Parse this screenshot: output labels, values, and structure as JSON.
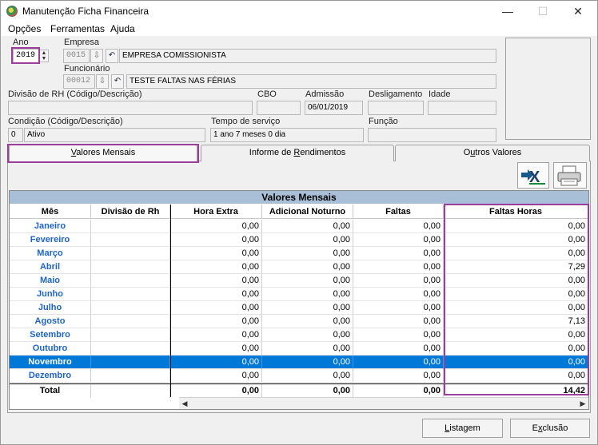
{
  "window": {
    "title": "Manutenção Ficha Financeira",
    "minimize": "—",
    "maximize": "☐",
    "close": "✕"
  },
  "menu": {
    "items": [
      "Opções",
      "Ferramentas",
      "Ajuda"
    ]
  },
  "form": {
    "ano_label": "Ano",
    "ano_value": "2019",
    "empresa_label": "Empresa",
    "empresa_code": "0015",
    "empresa_name": "EMPRESA COMISSIONISTA",
    "funcionario_label": "Funcionário",
    "funcionario_code": "00012",
    "funcionario_name": "TESTE FALTAS NAS FÉRIAS",
    "divisao_label": "Divisão de RH (Código/Descrição)",
    "divisao_value": "",
    "cbo_label": "CBO",
    "cbo_value": "",
    "admissao_label": "Admissão",
    "admissao_value": "06/01/2019",
    "desligamento_label": "Desligamento",
    "desligamento_value": "",
    "idade_label": "Idade",
    "idade_value": "",
    "condicao_label": "Condição (Código/Descrição)",
    "condicao_code": "0",
    "condicao_value": "Ativo",
    "tempo_label": "Tempo de serviço",
    "tempo_value": "1 ano 7 meses 0 dia",
    "funcao_label": "Função",
    "funcao_value": ""
  },
  "tabs": [
    {
      "label": "Valores Mensais",
      "accesskey_prefix": "",
      "underline": "V",
      "rest": "alores Mensais"
    },
    {
      "label": "Informe de Rendimentos",
      "accesskey_prefix": "Informe de ",
      "underline": "R",
      "rest": "endimentos"
    },
    {
      "label": "Outros Valores",
      "accesskey_prefix": "O",
      "underline": "u",
      "rest": "tros Valores"
    }
  ],
  "grid": {
    "title": "Valores Mensais",
    "columns": [
      "Mês",
      "Divisão de Rh",
      "Hora Extra",
      "Adicional Noturno",
      "Faltas",
      "Faltas Horas"
    ],
    "rows": [
      {
        "mes": "Janeiro",
        "divisao": "",
        "hora_extra": "0,00",
        "adicional": "0,00",
        "faltas": "0,00",
        "faltas_horas": "0,00"
      },
      {
        "mes": "Fevereiro",
        "divisao": "",
        "hora_extra": "0,00",
        "adicional": "0,00",
        "faltas": "0,00",
        "faltas_horas": "0,00"
      },
      {
        "mes": "Março",
        "divisao": "",
        "hora_extra": "0,00",
        "adicional": "0,00",
        "faltas": "0,00",
        "faltas_horas": "0,00"
      },
      {
        "mes": "Abril",
        "divisao": "",
        "hora_extra": "0,00",
        "adicional": "0,00",
        "faltas": "0,00",
        "faltas_horas": "7,29"
      },
      {
        "mes": "Maio",
        "divisao": "",
        "hora_extra": "0,00",
        "adicional": "0,00",
        "faltas": "0,00",
        "faltas_horas": "0,00"
      },
      {
        "mes": "Junho",
        "divisao": "",
        "hora_extra": "0,00",
        "adicional": "0,00",
        "faltas": "0,00",
        "faltas_horas": "0,00"
      },
      {
        "mes": "Julho",
        "divisao": "",
        "hora_extra": "0,00",
        "adicional": "0,00",
        "faltas": "0,00",
        "faltas_horas": "0,00"
      },
      {
        "mes": "Agosto",
        "divisao": "",
        "hora_extra": "0,00",
        "adicional": "0,00",
        "faltas": "0,00",
        "faltas_horas": "7,13"
      },
      {
        "mes": "Setembro",
        "divisao": "",
        "hora_extra": "0,00",
        "adicional": "0,00",
        "faltas": "0,00",
        "faltas_horas": "0,00"
      },
      {
        "mes": "Outubro",
        "divisao": "",
        "hora_extra": "0,00",
        "adicional": "0,00",
        "faltas": "0,00",
        "faltas_horas": "0,00"
      },
      {
        "mes": "Novembro",
        "divisao": "",
        "hora_extra": "0,00",
        "adicional": "0,00",
        "faltas": "0,00",
        "faltas_horas": "0,00"
      },
      {
        "mes": "Dezembro",
        "divisao": "",
        "hora_extra": "0,00",
        "adicional": "0,00",
        "faltas": "0,00",
        "faltas_horas": "0,00"
      }
    ],
    "selected_row": 10,
    "total": {
      "mes": "Total",
      "divisao": "",
      "hora_extra": "0,00",
      "adicional": "0,00",
      "faltas": "0,00",
      "faltas_horas": "14,42"
    }
  },
  "buttons": {
    "listagem_prefix": "",
    "listagem_underline": "L",
    "listagem_rest": "istagem",
    "exclusao_prefix": "E",
    "exclusao_underline": "x",
    "exclusao_rest": "clusão"
  },
  "colors": {
    "highlight": "#9b3f9b",
    "grid_header": "#a9bfd8",
    "selection": "#0078d7",
    "month_text": "#1e64c8"
  }
}
